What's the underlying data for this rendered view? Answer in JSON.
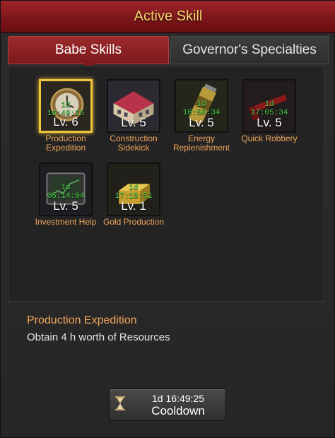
{
  "title": "Active Skill",
  "tabs": [
    {
      "label": "Babe Skills",
      "active": true
    },
    {
      "label": "Governor's Specialties",
      "active": false
    }
  ],
  "skills": [
    {
      "name": "Production Expedition",
      "timer": "1d 16:49:25",
      "level": "Lv. 6",
      "icon": "clock-icon",
      "selected": true
    },
    {
      "name": "Construction Sidekick",
      "timer": "",
      "level": "Lv. 5",
      "icon": "building-icon",
      "selected": false
    },
    {
      "name": "Energy Replenishment",
      "timer": "1d 16:50:34",
      "level": "Lv. 5",
      "icon": "energy-drink-icon",
      "selected": false
    },
    {
      "name": "Quick Robbery",
      "timer": "1d 17:05:34",
      "level": "Lv. 5",
      "icon": "crowbar-icon",
      "selected": false
    },
    {
      "name": "Investment Help",
      "timer": "1d 05:14:04",
      "level": "Lv. 5",
      "icon": "tablet-icon",
      "selected": false
    },
    {
      "name": "Gold Production",
      "timer": "1d 17:15:51",
      "level": "Lv. 1",
      "icon": "gold-bars-icon",
      "selected": false
    }
  ],
  "description": {
    "title": "Production Expedition",
    "text": "Obtain 4 h worth of Resources"
  },
  "cooldown": {
    "timer": "1d 16:49:25",
    "label": "Cooldown",
    "icon": "hourglass-icon"
  },
  "colors": {
    "accent": "#f0a65a",
    "timer": "#4cd24c",
    "title": "#ffd36a",
    "selected": "#f0c53a"
  }
}
